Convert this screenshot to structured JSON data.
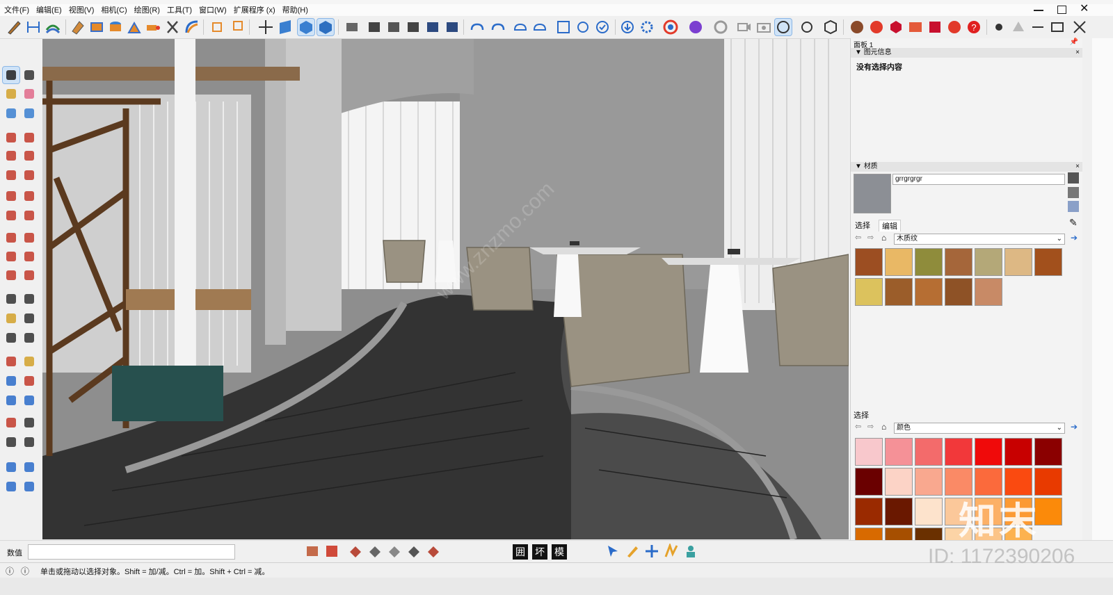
{
  "menu": [
    "文件(F)",
    "编辑(E)",
    "视图(V)",
    "相机(C)",
    "绘图(R)",
    "工具(T)",
    "窗口(W)",
    "扩展程序 (x)",
    "帮助(H)"
  ],
  "tray": {
    "panel_title": "面板 1",
    "entity_info": {
      "title": "图元信息",
      "message": "没有选择内容"
    },
    "materials": {
      "title": "材质",
      "current_name": "grrgrgrgr",
      "tabs": [
        "选择",
        "编辑"
      ],
      "library": "木质纹",
      "secondary_label": "选择",
      "secondary_library": "颜色"
    }
  },
  "status": {
    "value_label": "数值",
    "hint": "单击或拖动以选择对象。Shift = 加/减。Ctrl = 加。Shift + Ctrl = 减。"
  },
  "style_buttons": [
    "囲",
    "坏",
    "模"
  ],
  "watermark": {
    "brand": "知末",
    "id": "ID: 1172390206",
    "site": "www.znzmo.com"
  },
  "colors": {
    "wood_swatches": [
      "#9c4e22",
      "#e9b865",
      "#8f8c3b",
      "#a5663a",
      "#b4a878",
      "#ddb884",
      "#a2501c",
      "#dcc25d",
      "#9b5d2a",
      "#b66e33",
      "#8e5226",
      "#c88a66"
    ],
    "color_swatches": [
      "#f8c8cc",
      "#f59197",
      "#f36b6b",
      "#f2383a",
      "#f00a0a",
      "#c80000",
      "#8b0000",
      "#6a0000",
      "#fcd3c6",
      "#f9a88f",
      "#fa8a66",
      "#fb6a3c",
      "#fa4a10",
      "#e83a00",
      "#9a2a00",
      "#6a1800",
      "#fde3cc",
      "#fbc89a",
      "#fcb066",
      "#fc9a33",
      "#fb8a0a",
      "#d86a00",
      "#a64f00",
      "#6a3000",
      "#fcd4a6",
      "#fcc487",
      "#fcb24f"
    ]
  }
}
